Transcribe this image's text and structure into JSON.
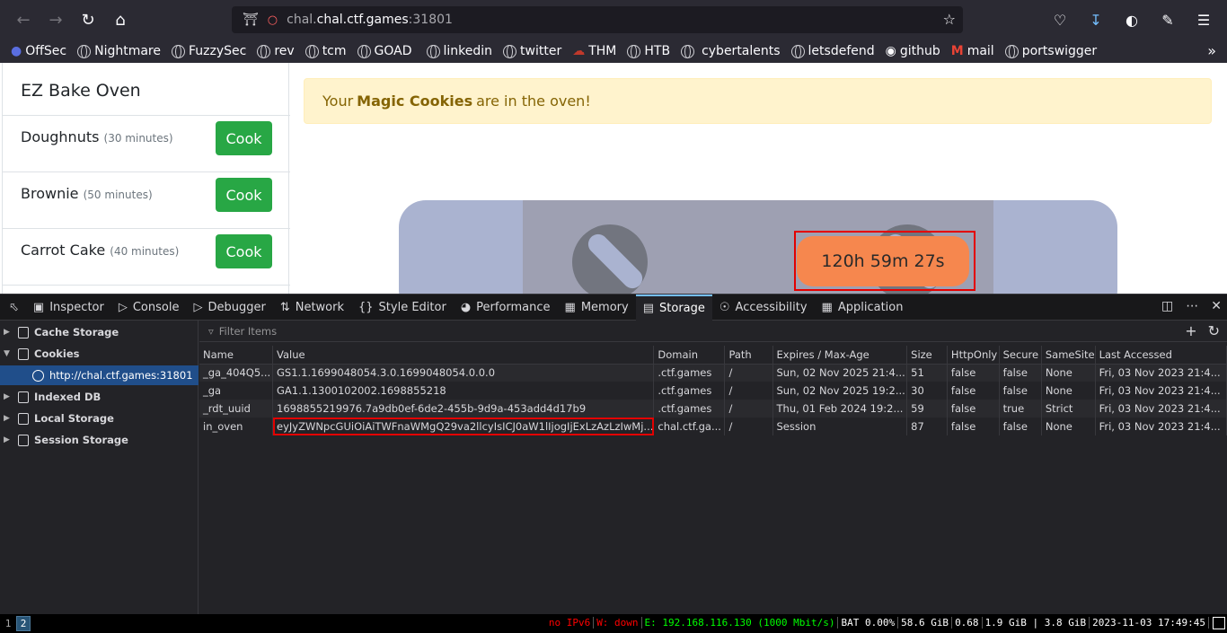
{
  "browser": {
    "url_host": "chal.ctf.games",
    "url_port": ":31801",
    "url_sub": "chal."
  },
  "bookmarks": [
    "OffSec",
    "Nightmare",
    "FuzzySec",
    "rev",
    "tcm",
    "GOAD",
    "linkedin",
    "twitter",
    "THM",
    "HTB",
    "cybertalents",
    "letsdefend",
    "github",
    "mail",
    "portswigger"
  ],
  "page": {
    "panel_title": "EZ Bake Oven",
    "recipes": [
      {
        "name": "Doughnuts",
        "minutes": "(30 minutes)",
        "button": "Cook"
      },
      {
        "name": "Brownie",
        "minutes": "(50 minutes)",
        "button": "Cook"
      },
      {
        "name": "Carrot Cake",
        "minutes": "(40 minutes)",
        "button": "Cook"
      }
    ],
    "alert_prefix": "Your",
    "alert_bold": "Magic Cookies",
    "alert_suffix": "are in the oven!",
    "timer": "120h 59m 27s"
  },
  "devtools": {
    "tabs": [
      "Inspector",
      "Console",
      "Debugger",
      "Network",
      "Style Editor",
      "Performance",
      "Memory",
      "Storage",
      "Accessibility",
      "Application"
    ],
    "active_tab": "Storage",
    "sidebar": {
      "cache_storage": "Cache Storage",
      "cookies": "Cookies",
      "cookie_host": "http://chal.ctf.games:31801",
      "indexed_db": "Indexed DB",
      "local_storage": "Local Storage",
      "session_storage": "Session Storage"
    },
    "filter_placeholder": "Filter Items",
    "columns": [
      "Name",
      "Value",
      "Domain",
      "Path",
      "Expires / Max-Age",
      "Size",
      "HttpOnly",
      "Secure",
      "SameSite",
      "Last Accessed"
    ],
    "rows": [
      [
        "_ga_404Q5...",
        "GS1.1.1699048054.3.0.1699048054.0.0.0",
        ".ctf.games",
        "/",
        "Sun, 02 Nov 2025 21:4...",
        "51",
        "false",
        "false",
        "None",
        "Fri, 03 Nov 2023 21:4..."
      ],
      [
        "_ga",
        "GA1.1.1300102002.1698855218",
        ".ctf.games",
        "/",
        "Sun, 02 Nov 2025 19:2...",
        "30",
        "false",
        "false",
        "None",
        "Fri, 03 Nov 2023 21:4..."
      ],
      [
        "_rdt_uuid",
        "1698855219976.7a9db0ef-6de2-455b-9d9a-453add4d17b9",
        ".ctf.games",
        "/",
        "Thu, 01 Feb 2024 19:2...",
        "59",
        "false",
        "true",
        "Strict",
        "Fri, 03 Nov 2023 21:4..."
      ],
      [
        "in_oven",
        "eyJyZWNpcGUiOiAiTWFnaWMgQ29va2llcyIsICJ0aW1lIjogIjExLzAzLzIwMj...",
        "chal.ctf.ga...",
        "/",
        "Session",
        "87",
        "false",
        "false",
        "None",
        "Fri, 03 Nov 2023 21:4..."
      ]
    ]
  },
  "statusbar": {
    "workspaces": [
      "1",
      "2"
    ],
    "ipv6": "no IPv6",
    "wifi": "W: down",
    "eth": "E: 192.168.116.130 (1000 Mbit/s)",
    "bat": "BAT 0.00%",
    "disk": "58.6 GiB",
    "load": "0.68",
    "mem": "1.9 GiB | 3.8 GiB",
    "datetime": "2023-11-03 17:49:45"
  }
}
